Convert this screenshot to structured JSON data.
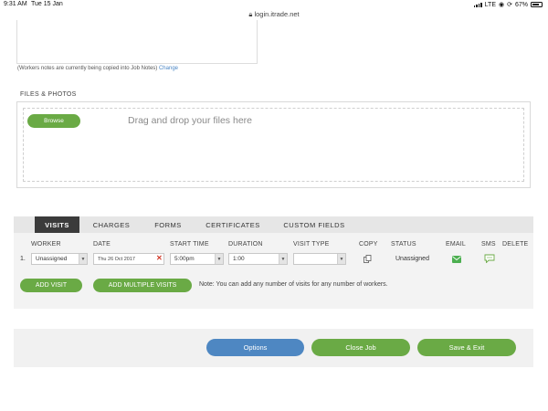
{
  "status_bar": {
    "time": "9:31 AM",
    "date": "Tue 15 Jan",
    "url": "login.itrade.net",
    "carrier": "LTE",
    "battery": "67%",
    "icons": [
      "signal-icon",
      "wifi-icon",
      "lock-icon",
      "battery-icon"
    ]
  },
  "notes": {
    "text": "(Workers notes are currently being copied into Job Notes)",
    "change_link": "Change"
  },
  "files": {
    "title": "FILES & PHOTOS",
    "browse_label": "Browse",
    "drop_text": "Drag and drop your files here"
  },
  "tabs": [
    {
      "label": "VISITS",
      "active": true
    },
    {
      "label": "CHARGES",
      "active": false
    },
    {
      "label": "FORMS",
      "active": false
    },
    {
      "label": "CERTIFICATES",
      "active": false
    },
    {
      "label": "CUSTOM FIELDS",
      "active": false
    }
  ],
  "visits": {
    "columns": [
      "WORKER",
      "DATE",
      "START TIME",
      "DURATION",
      "VISIT TYPE",
      "COPY",
      "STATUS",
      "EMAIL",
      "SMS",
      "DELETE"
    ],
    "rows": [
      {
        "num": "1.",
        "worker": "Unassigned",
        "date": "Thu 26 Oct 2017",
        "start_time": "5:00pm",
        "duration": "1:00",
        "visit_type": "",
        "status": "Unassigned"
      }
    ],
    "add_visit_label": "ADD VISIT",
    "add_multiple_label": "ADD MULTIPLE VISITS",
    "note": "Note: You can add any number of visits for any number of workers."
  },
  "footer": {
    "options_label": "Options",
    "close_label": "Close Job",
    "save_label": "Save & Exit"
  },
  "colors": {
    "green": "#6aaa45",
    "blue": "#4e87c2",
    "active_tab": "#3b3b3b",
    "clear_red": "#d23a2a"
  }
}
